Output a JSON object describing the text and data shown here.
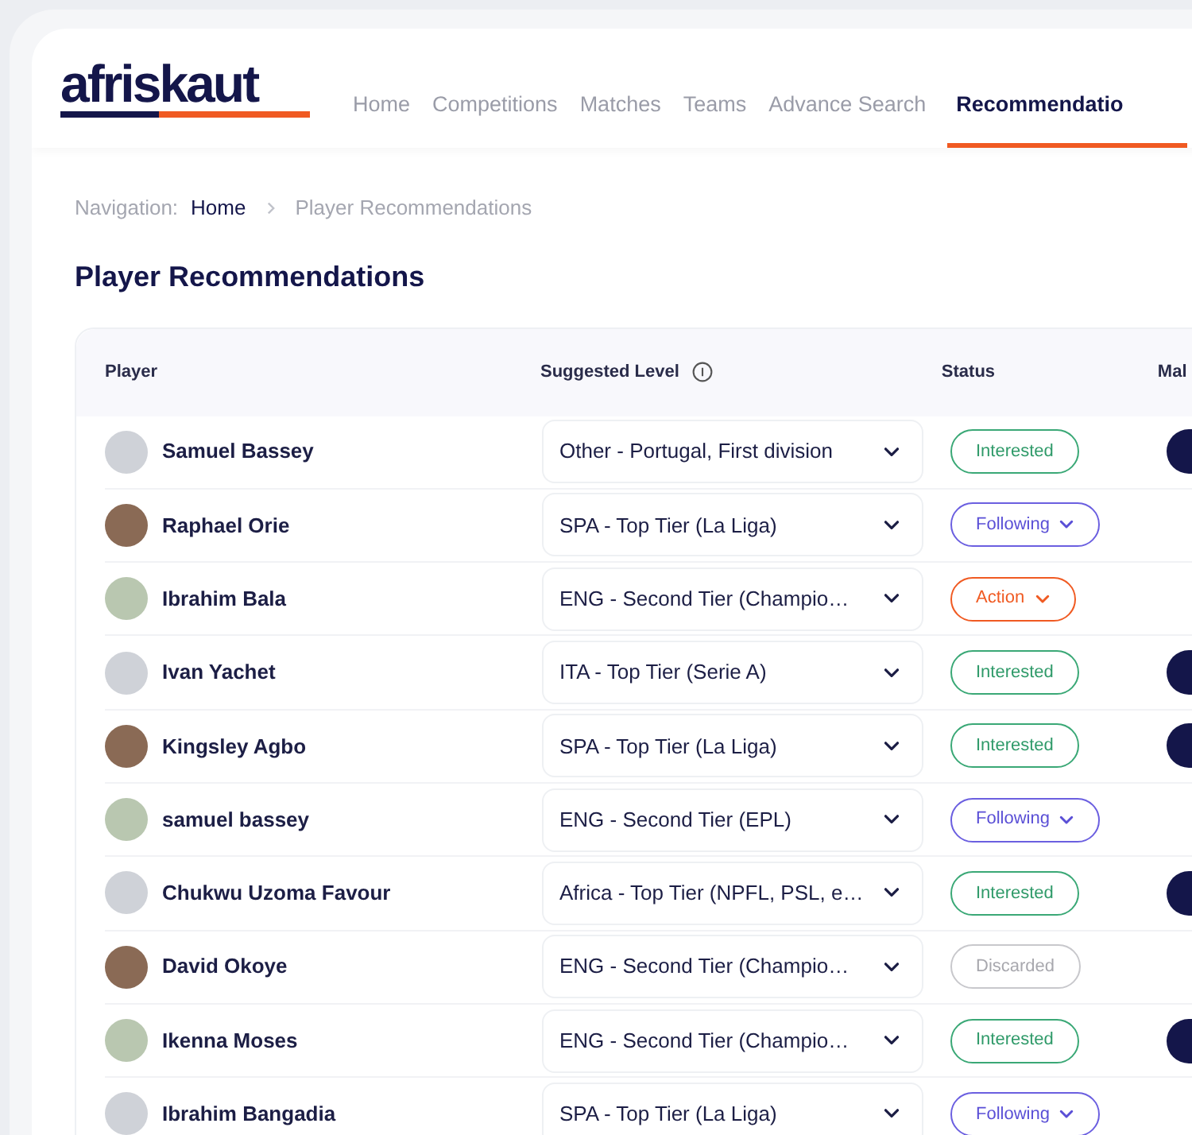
{
  "logo": {
    "text": "afriskaut"
  },
  "nav": [
    {
      "label": "Home",
      "selected": false
    },
    {
      "label": "Competitions",
      "selected": false
    },
    {
      "label": "Matches",
      "selected": false
    },
    {
      "label": "Teams",
      "selected": false
    },
    {
      "label": "Advance Search",
      "selected": false
    },
    {
      "label": "Recommendatio",
      "selected": true
    }
  ],
  "breadcrumb": {
    "prefix": "Navigation:",
    "items": [
      "Home",
      "Player Recommendations"
    ]
  },
  "title": "Player Recommendations",
  "table": {
    "columns": [
      "Player",
      "Suggested Level",
      "Status",
      "Mal"
    ],
    "rows": [
      {
        "player": "Samuel Bassey",
        "level": "Other - Portugal, First division",
        "status": {
          "kind": "interested",
          "label": "Interested"
        },
        "has_button": true
      },
      {
        "player": "Raphael Orie",
        "level": "SPA - Top Tier (La Liga)",
        "status": {
          "kind": "following",
          "label": "Following"
        },
        "has_button": false
      },
      {
        "player": "Ibrahim Bala",
        "level": "ENG - Second Tier (Champio…",
        "status": {
          "kind": "action",
          "label": "Action"
        },
        "has_button": false
      },
      {
        "player": "Ivan Yachet",
        "level": "ITA - Top Tier (Serie A)",
        "status": {
          "kind": "interested",
          "label": "Interested"
        },
        "has_button": true
      },
      {
        "player": "Kingsley Agbo",
        "level": "SPA - Top Tier (La Liga)",
        "status": {
          "kind": "interested",
          "label": "Interested"
        },
        "has_button": true
      },
      {
        "player": "samuel bassey",
        "level": "ENG - Second Tier (EPL)",
        "status": {
          "kind": "following",
          "label": "Following"
        },
        "has_button": false
      },
      {
        "player": "Chukwu Uzoma Favour",
        "level": "Africa - Top Tier (NPFL, PSL, e…",
        "status": {
          "kind": "interested",
          "label": "Interested"
        },
        "has_button": true
      },
      {
        "player": "David Okoye",
        "level": "ENG - Second Tier (Champio…",
        "status": {
          "kind": "discarded",
          "label": "Discarded"
        },
        "has_button": false
      },
      {
        "player": "Ikenna Moses",
        "level": "ENG - Second Tier (Champio…",
        "status": {
          "kind": "interested",
          "label": "Interested"
        },
        "has_button": true
      },
      {
        "player": "Ibrahim Bangadia",
        "level": "SPA - Top Tier (La Liga)",
        "status": {
          "kind": "following",
          "label": "Following"
        },
        "has_button": false
      }
    ]
  }
}
